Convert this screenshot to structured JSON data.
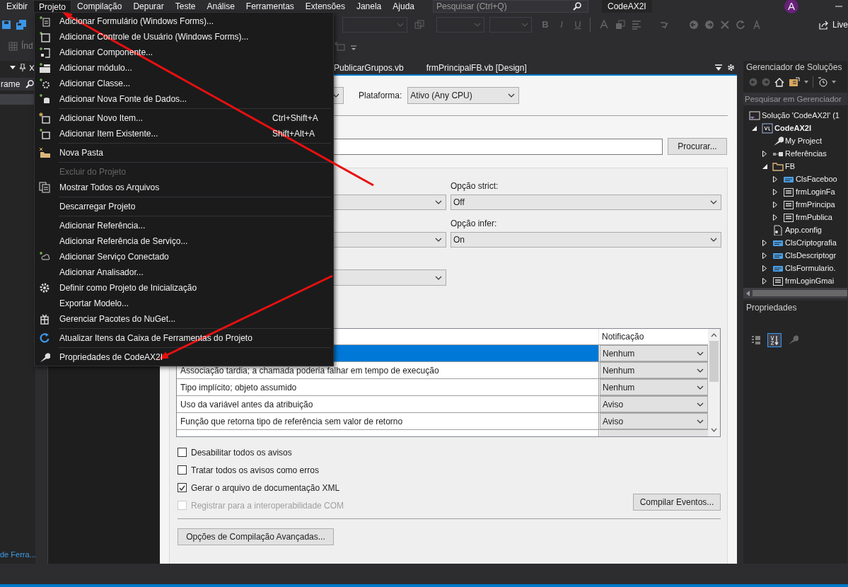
{
  "menu_bar": {
    "items": [
      {
        "label": "Exibir",
        "selected": false
      },
      {
        "label": "Projeto",
        "selected": true
      },
      {
        "label": "Compilação",
        "selected": false
      },
      {
        "label": "Depurar",
        "selected": false
      },
      {
        "label": "Teste",
        "selected": false
      },
      {
        "label": "Análise",
        "selected": false
      },
      {
        "label": "Ferramentas",
        "selected": false
      },
      {
        "label": "Extensões",
        "selected": false
      },
      {
        "label": "Janela",
        "selected": false
      },
      {
        "label": "Ajuda",
        "selected": false
      }
    ],
    "search": {
      "placeholder": "Pesquisar (Ctrl+Q)"
    },
    "solution_name": "CodeAX2I",
    "avatar": "A"
  },
  "toolbar": {
    "combo_text": "Índ",
    "format_buttons": [
      "B",
      "I",
      "U"
    ],
    "share_button": "Live"
  },
  "left_panel": {
    "search_value": "rame",
    "bottom_tab": "de Ferra..."
  },
  "document_tabs": [
    {
      "label": "PublicarGrupos.vb",
      "selected": false
    },
    {
      "label": "frmPrincipalFB.vb [Design]",
      "selected": false
    }
  ],
  "project_menu": {
    "items": [
      {
        "kind": "item",
        "label": "Adicionar Formulário (Windows Forms)...",
        "disabled": false
      },
      {
        "kind": "item",
        "label": "Adicionar Controle de Usuário (Windows Forms)...",
        "disabled": false
      },
      {
        "kind": "item",
        "label": "Adicionar Componente...",
        "disabled": false
      },
      {
        "kind": "item",
        "label": "Adicionar módulo...",
        "disabled": false
      },
      {
        "kind": "item",
        "label": "Adicionar Classe...",
        "disabled": false
      },
      {
        "kind": "item",
        "label": "Adicionar Nova Fonte de Dados...",
        "disabled": false
      },
      {
        "kind": "separator"
      },
      {
        "kind": "item",
        "label": "Adicionar Novo Item...",
        "shortcut": "Ctrl+Shift+A",
        "disabled": false
      },
      {
        "kind": "item",
        "label": "Adicionar Item Existente...",
        "shortcut": "Shift+Alt+A",
        "disabled": false
      },
      {
        "kind": "separator"
      },
      {
        "kind": "item",
        "label": "Nova Pasta",
        "disabled": false
      },
      {
        "kind": "separator"
      },
      {
        "kind": "item",
        "label": "Excluir do Projeto",
        "disabled": true
      },
      {
        "kind": "item",
        "label": "Mostrar Todos os Arquivos",
        "disabled": false
      },
      {
        "kind": "separator"
      },
      {
        "kind": "item",
        "label": "Descarregar Projeto",
        "disabled": false
      },
      {
        "kind": "separator"
      },
      {
        "kind": "item",
        "label": "Adicionar Referência...",
        "disabled": false
      },
      {
        "kind": "item",
        "label": "Adicionar Referência de Serviço...",
        "disabled": false
      },
      {
        "kind": "item",
        "label": "Adicionar Serviço Conectado",
        "disabled": false
      },
      {
        "kind": "item",
        "label": "Adicionar Analisador...",
        "disabled": false
      },
      {
        "kind": "item",
        "label": "Definir como Projeto de Inicialização",
        "disabled": false
      },
      {
        "kind": "item",
        "label": "Exportar Modelo...",
        "disabled": false
      },
      {
        "kind": "item",
        "label": "Gerenciar Pacotes do NuGet...",
        "disabled": false
      },
      {
        "kind": "separator"
      },
      {
        "kind": "item",
        "label": "Atualizar Itens da Caixa de Ferramentas do Projeto",
        "disabled": false
      },
      {
        "kind": "separator"
      },
      {
        "kind": "item",
        "label": "Propriedades de CodeAX2I",
        "disabled": false
      }
    ]
  },
  "properties_page": {
    "platform": {
      "label": "Plataforma:",
      "value": "Ativo (Any CPU)"
    },
    "browse_button": "Procurar...",
    "option_strict": {
      "label": "Opção strict:",
      "value": "Off"
    },
    "option_infer": {
      "label": "Opção infer:",
      "value": "On"
    },
    "warnings_table": {
      "notification_column": "Notificação",
      "rows": [
        {
          "notification": "Nenhum",
          "selected": true
        },
        {
          "condition": "Associação tardia; a chamada poderia falhar em tempo de execução",
          "notification": "Nenhum",
          "selected": false
        },
        {
          "condition": "Tipo implícito; objeto assumido",
          "notification": "Nenhum",
          "selected": false
        },
        {
          "condition": "Uso da variável antes da atribuição",
          "notification": "Aviso",
          "selected": false
        },
        {
          "condition": "Função que retorna tipo de referência sem valor de retorno",
          "notification": "Aviso",
          "selected": false
        }
      ]
    },
    "checkboxes": [
      {
        "label": "Desabilitar todos os avisos",
        "checked": false,
        "disabled": false
      },
      {
        "label": "Tratar todos os avisos como erros",
        "checked": false,
        "disabled": false
      },
      {
        "label": "Gerar o arquivo de documentação XML",
        "checked": true,
        "disabled": false
      },
      {
        "label": "Registrar para a interoperabilidade COM",
        "checked": false,
        "disabled": true
      }
    ],
    "build_events_button": "Compilar Eventos...",
    "advanced_button": "Opções de Compilação Avançadas..."
  },
  "solution_explorer": {
    "title": "Gerenciador de Soluções",
    "search_placeholder": "Pesquisar em Gerenciador",
    "tree": [
      {
        "kind": "solution",
        "label": "Solução 'CodeAX2I' (1",
        "children": [
          {
            "kind": "project",
            "label": "CodeAX2I",
            "expanded": true,
            "children": [
              {
                "kind": "my-project",
                "label": "My Project"
              },
              {
                "kind": "references",
                "label": "Referências",
                "expanded": false
              },
              {
                "kind": "folder",
                "label": "FB",
                "expanded": true,
                "children": [
                  {
                    "kind": "vb",
                    "label": "ClsFaceboo",
                    "expanded": false
                  },
                  {
                    "kind": "form",
                    "label": "frmLoginFa",
                    "expanded": false
                  },
                  {
                    "kind": "form",
                    "label": "frmPrincipa",
                    "expanded": false
                  },
                  {
                    "kind": "form",
                    "label": "frmPublica",
                    "expanded": false
                  }
                ]
              },
              {
                "kind": "config",
                "label": "App.config"
              },
              {
                "kind": "vb",
                "label": "ClsCriptografia",
                "expanded": false
              },
              {
                "kind": "vb",
                "label": "ClsDescriptogr",
                "expanded": false
              },
              {
                "kind": "vb",
                "label": "ClsFormulario.",
                "expanded": false
              },
              {
                "kind": "form",
                "label": "frmLoginGmai",
                "expanded": false
              }
            ]
          }
        ]
      }
    ]
  },
  "properties_panel": {
    "title": "Propriedades",
    "view_buttons": [
      {
        "selected": false
      },
      {
        "selected": true
      },
      {
        "selected": false
      }
    ]
  }
}
